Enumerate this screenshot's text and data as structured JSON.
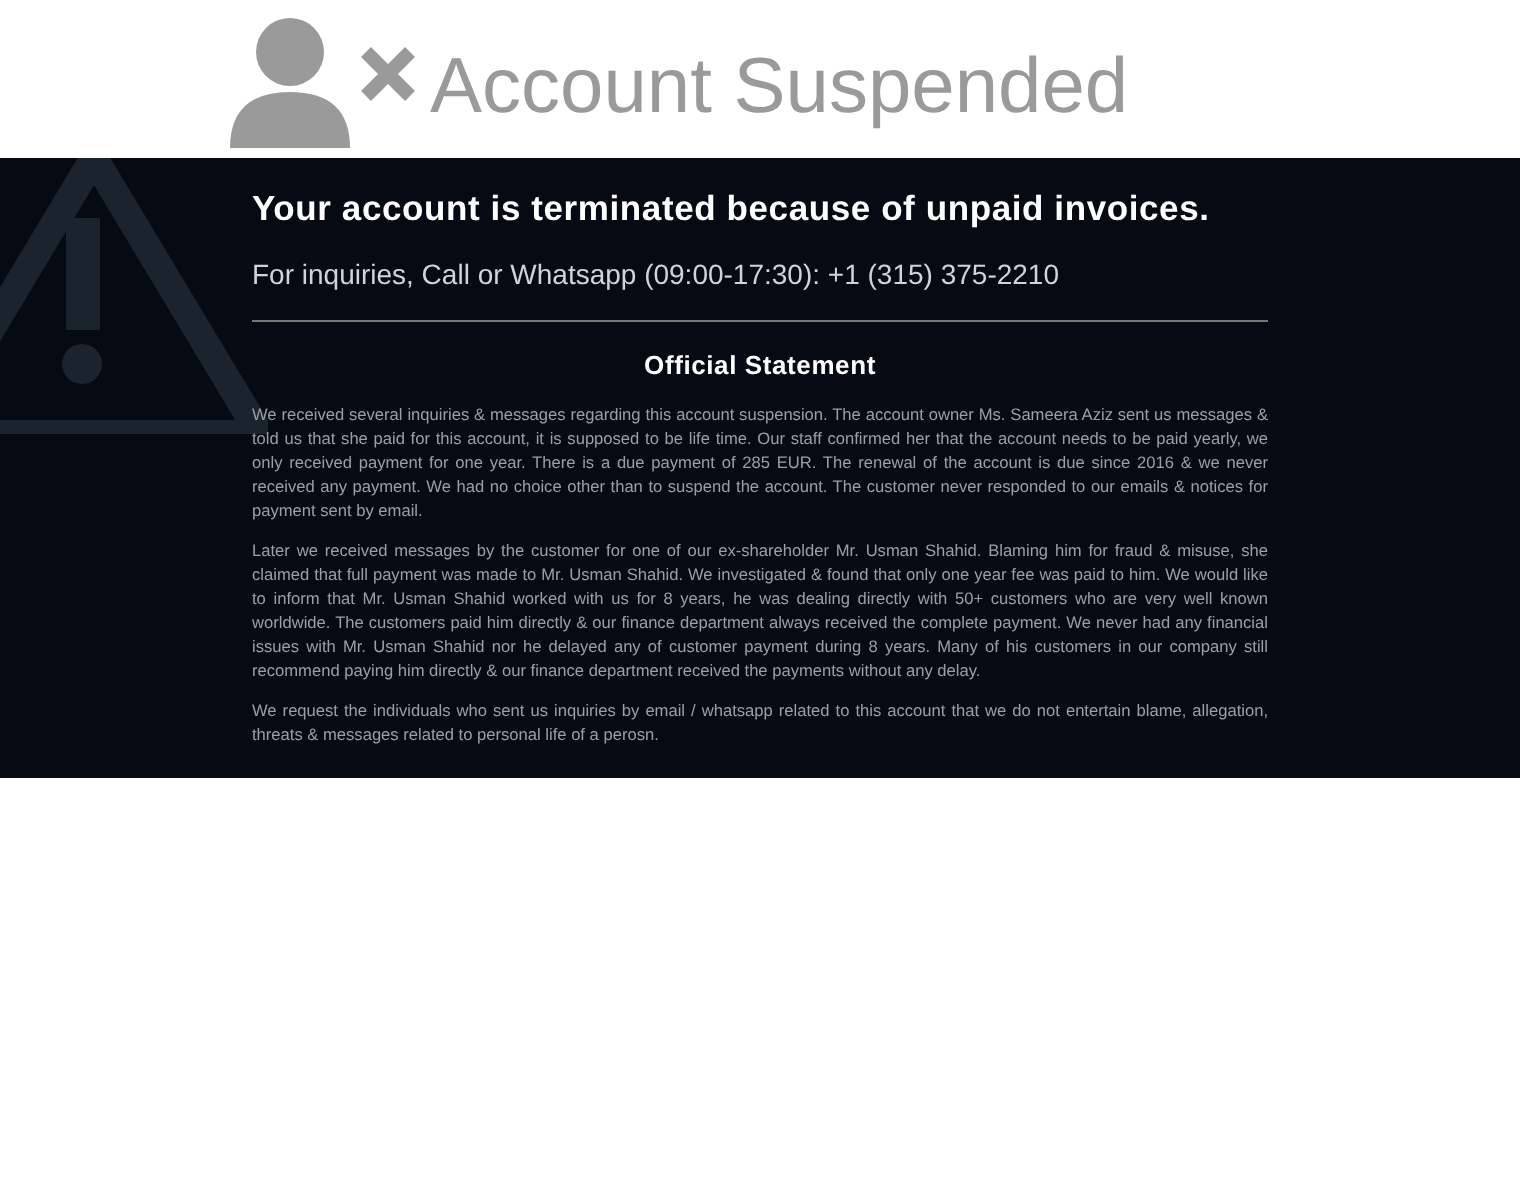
{
  "header": {
    "title": "Account Suspended"
  },
  "notice": {
    "heading": "Your account is terminated because of unpaid invoices.",
    "contact": "For inquiries, Call or Whatsapp (09:00-17:30): +1 (315) 375-2210",
    "statement_title": "Official Statement",
    "paragraphs": [
      "We received several inquiries & messages regarding this account suspension. The account owner Ms. Sameera Aziz sent us messages & told us that she paid for this account, it is supposed to be life time. Our staff confirmed her that the account needs to be paid yearly, we only received payment for one year. There is a due payment of 285 EUR. The renewal of the account is due since 2016 & we never received any payment. We had no choice other than to suspend the account. The customer never responded to our emails & notices for payment sent by email.",
      "Later we received messages by the customer for one of our ex-shareholder Mr. Usman Shahid. Blaming him for fraud & misuse, she claimed that full payment was made to Mr. Usman Shahid. We investigated & found that only one year fee was paid to him. We would like to inform that Mr. Usman Shahid worked with us for 8 years, he was dealing directly with 50+ customers who are very well known worldwide. The customers paid him directly & our finance department always received the complete payment. We never had any financial issues with Mr. Usman Shahid nor he delayed any of customer payment during 8 years. Many of his customers in our company still recommend paying him directly & our finance department received the payments without any delay.",
      "We request the individuals who sent us inquiries by email / whatsapp related to this account that we do not entertain blame, allegation, threats & messages related to personal life of a perosn."
    ]
  }
}
